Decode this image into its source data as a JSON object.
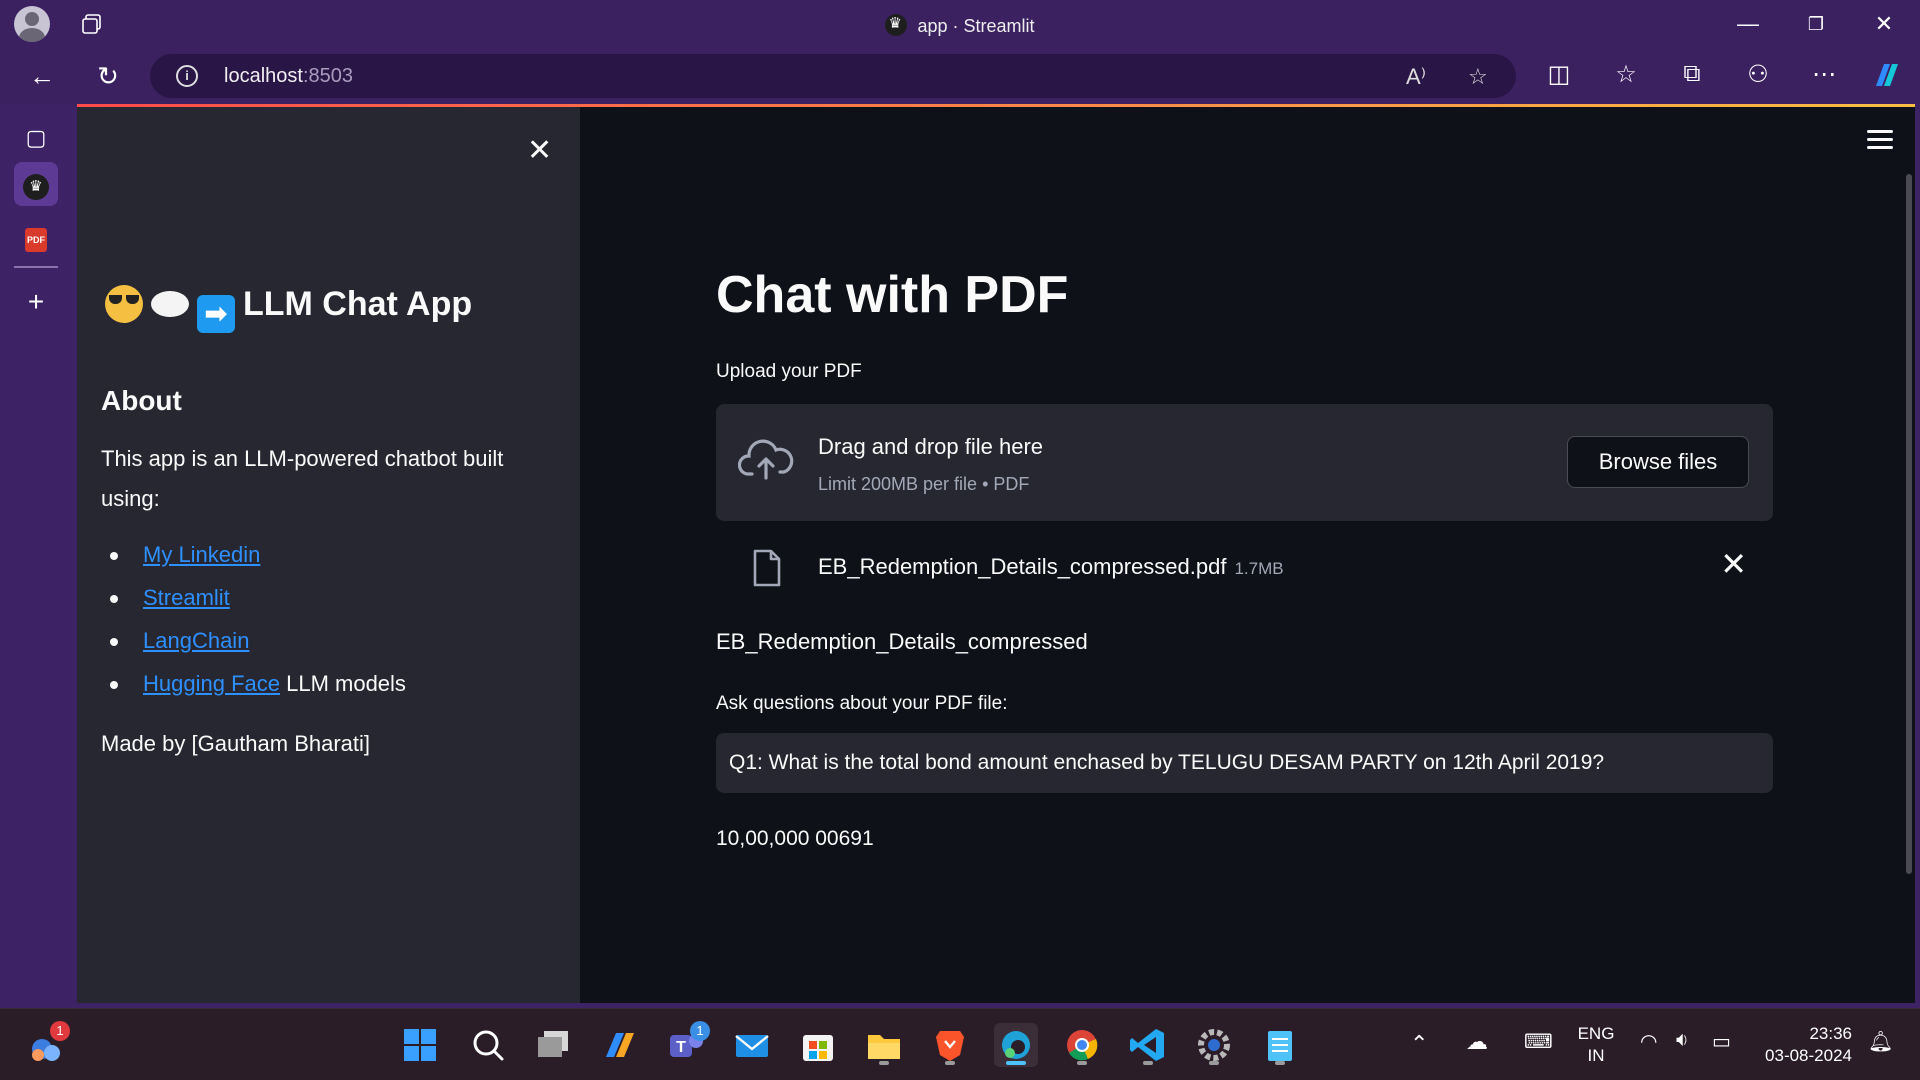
{
  "browser": {
    "window_title": "app · Streamlit",
    "address_host": "localhost",
    "address_port": ":8503"
  },
  "sidebar": {
    "title": "LLM Chat App",
    "about_heading": "About",
    "description": "This app is an LLM-powered chatbot built using:",
    "links": [
      {
        "link": "My Linkedin",
        "suffix": ""
      },
      {
        "link": "Streamlit",
        "suffix": ""
      },
      {
        "link": "LangChain",
        "suffix": ""
      },
      {
        "link": "Hugging Face",
        "suffix": " LLM models"
      }
    ],
    "made_by": "Made by [Gautham Bharati]"
  },
  "main": {
    "title": "Chat with PDF",
    "upload_label": "Upload your PDF",
    "dropzone_title": "Drag and drop file here",
    "dropzone_limit": "Limit 200MB per file • PDF",
    "browse_button": "Browse files",
    "file_name": "EB_Redemption_Details_compressed.pdf",
    "file_size": "1.7MB",
    "document_name": "EB_Redemption_Details_compressed",
    "ask_label": "Ask questions about your PDF file:",
    "question_value": "Q1: What is the total bond amount enchased by TELUGU DESAM PARTY on 12th April 2019?",
    "answer": "10,00,000 00691"
  },
  "taskbar": {
    "language": "ENG",
    "region": "IN",
    "time": "23:36",
    "date": "03-08-2024",
    "weather_badge": "1",
    "teams_badge": "1"
  }
}
